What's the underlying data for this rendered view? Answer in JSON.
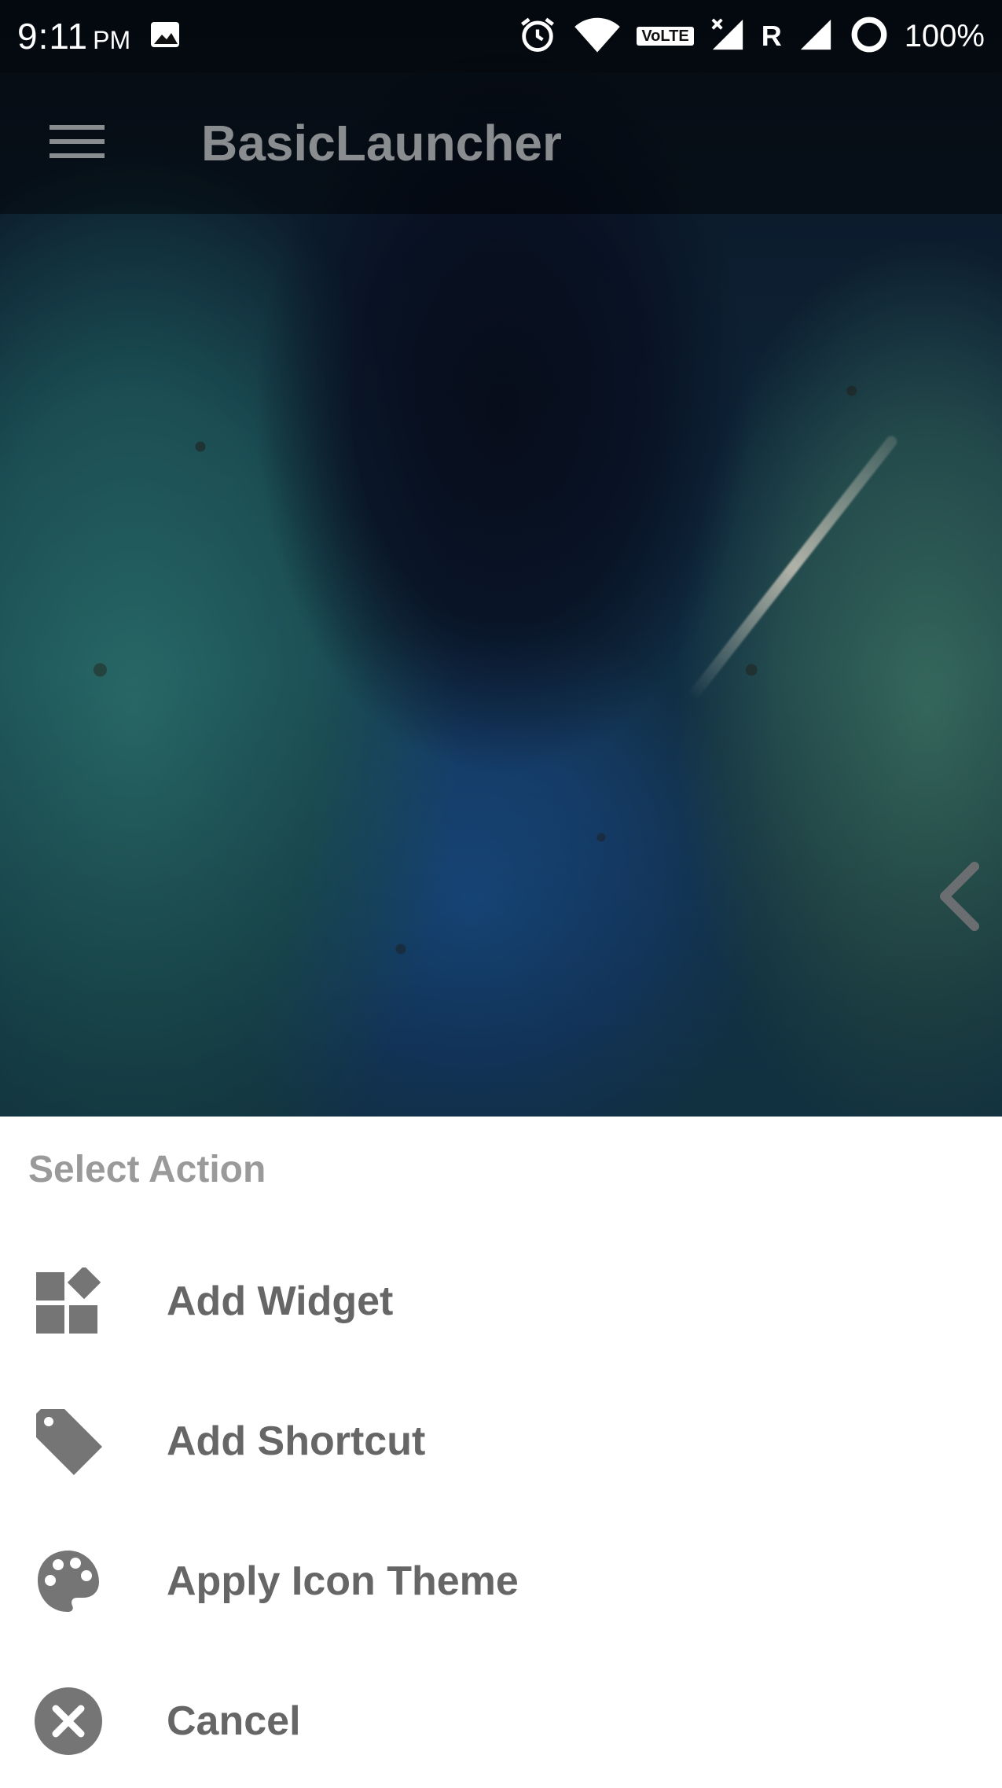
{
  "status_bar": {
    "time": "9:11",
    "ampm": "PM",
    "network_badge": "VoLTE",
    "roaming": "R",
    "battery": "100%",
    "icons": [
      "image-icon",
      "alarm-icon",
      "wifi-icon",
      "volte-icon",
      "signal-icon",
      "roaming-signal-icon",
      "battery-ring-icon"
    ]
  },
  "app_bar": {
    "title": "BasicLauncher",
    "menu_icon": "hamburger-menu-icon"
  },
  "home": {
    "pager_icon": "chevron-left-icon"
  },
  "sheet": {
    "title": "Select Action",
    "items": [
      {
        "label": "Add Widget",
        "icon": "widgets-icon"
      },
      {
        "label": "Add Shortcut",
        "icon": "tag-icon"
      },
      {
        "label": "Apply Icon Theme",
        "icon": "palette-icon"
      },
      {
        "label": "Cancel",
        "icon": "cancel-icon"
      }
    ]
  },
  "colors": {
    "sheet_background": "#ffffff",
    "label_text": "#666666",
    "sheet_title_text": "#9a9a9a",
    "app_title_text": "#8a8d90",
    "icon_gray": "#757575"
  }
}
